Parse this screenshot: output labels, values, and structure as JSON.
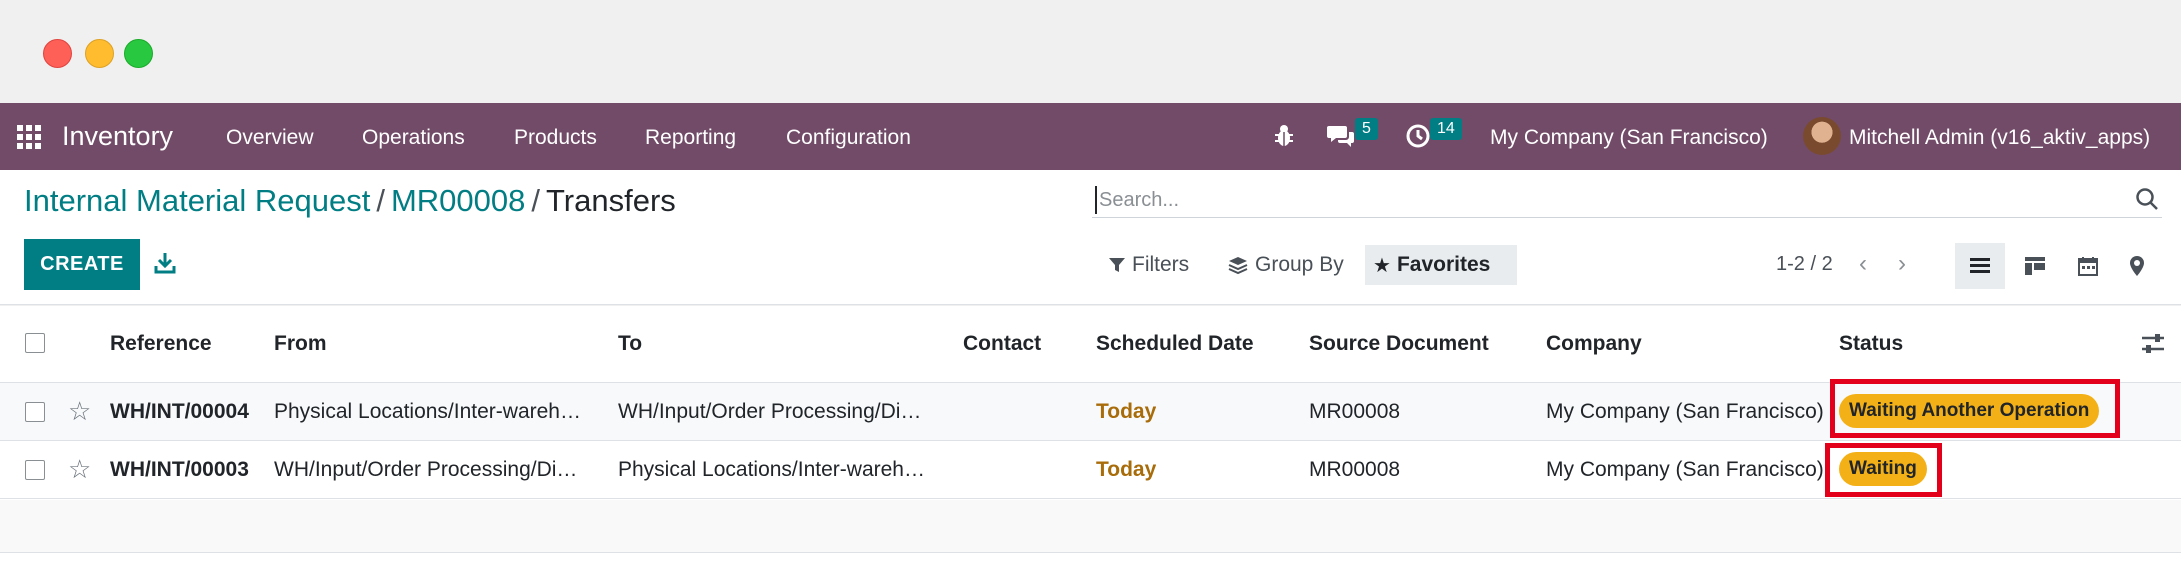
{
  "navbar": {
    "app_name": "Inventory",
    "menu": [
      "Overview",
      "Operations",
      "Products",
      "Reporting",
      "Configuration"
    ],
    "messages_count": "5",
    "activities_count": "14",
    "company": "My Company (San Francisco)",
    "user": "Mitchell Admin (v16_aktiv_apps)",
    "color": "#714b67"
  },
  "breadcrumb": {
    "items": [
      "Internal Material Request",
      "MR00008"
    ],
    "separator": "/",
    "current": "Transfers"
  },
  "search": {
    "placeholder": "Search..."
  },
  "toolbar": {
    "create_label": "CREATE",
    "filters_label": "Filters",
    "groupby_label": "Group By",
    "favorites_label": "Favorites",
    "pager": "1-2 / 2"
  },
  "table": {
    "columns": [
      "Reference",
      "From",
      "To",
      "Contact",
      "Scheduled Date",
      "Source Document",
      "Company",
      "Status"
    ],
    "rows": [
      {
        "reference": "WH/INT/00004",
        "from": "Physical Locations/Inter-wareh…",
        "to": "WH/Input/Order Processing/Di…",
        "contact": "",
        "scheduled": "Today",
        "source": "MR00008",
        "company": "My Company (San Francisco)",
        "status": "Waiting Another Operation"
      },
      {
        "reference": "WH/INT/00003",
        "from": "WH/Input/Order Processing/Di…",
        "to": "Physical Locations/Inter-wareh…",
        "contact": "",
        "scheduled": "Today",
        "source": "MR00008",
        "company": "My Company (San Francisco)",
        "status": "Waiting"
      }
    ]
  },
  "colors": {
    "accent": "#017e84",
    "status_badge": "#f3b117",
    "today": "#a86c0a",
    "highlight": "#e3001b"
  }
}
